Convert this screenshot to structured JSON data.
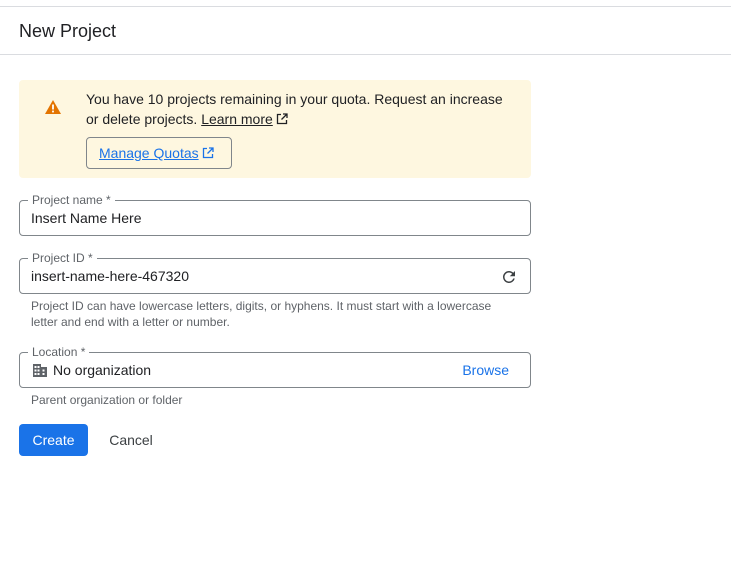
{
  "header": {
    "title": "New Project"
  },
  "banner": {
    "message": "You have 10 projects remaining in your quota. Request an increase or delete projects.",
    "learn_more": "Learn more",
    "manage_quotas": "Manage Quotas"
  },
  "project_name": {
    "label": "Project name *",
    "value": "Insert Name Here"
  },
  "project_id": {
    "label": "Project ID *",
    "value": "insert-name-here-467320",
    "hint": "Project ID can have lowercase letters, digits, or hyphens. It must start with a lowercase letter and end with a letter or number."
  },
  "location": {
    "label": "Location *",
    "value": "No organization",
    "browse": "Browse",
    "hint": "Parent organization or folder"
  },
  "actions": {
    "create": "Create",
    "cancel": "Cancel"
  },
  "colors": {
    "primary": "#1a73e8",
    "warning": "#e37400",
    "banner_bg": "#fef7e0"
  }
}
